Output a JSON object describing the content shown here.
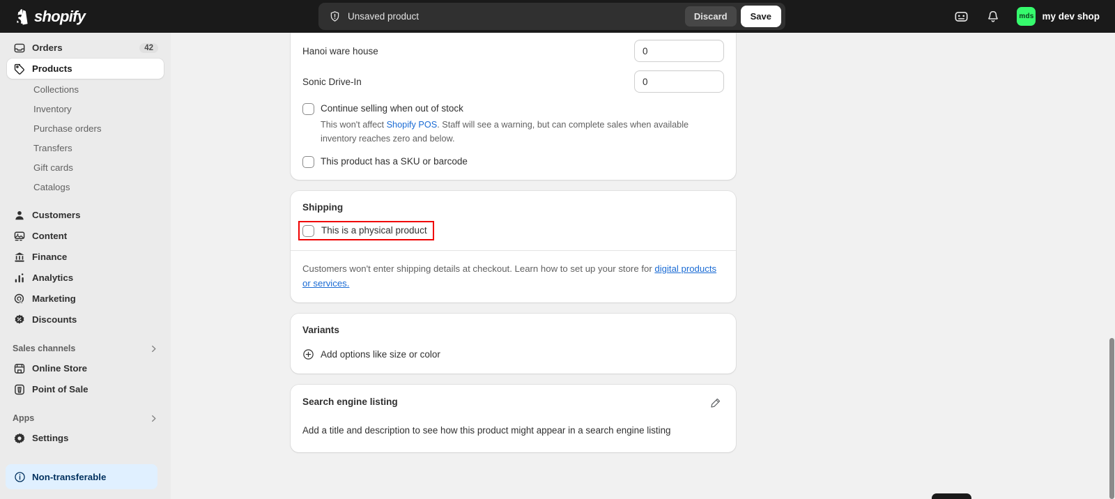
{
  "topbar": {
    "logo_name": "shopify-logo",
    "brand_word": "shopify",
    "savebar": {
      "status_text": "Unsaved product",
      "discard_label": "Discard",
      "save_label": "Save"
    },
    "store_icon": "store-icon",
    "notifications_icon": "bell-icon",
    "avatar_initials": "mds",
    "shop_name": "my dev shop"
  },
  "sidebar": {
    "items": [
      {
        "label": "Orders",
        "icon": "orders-inbox-icon",
        "badge": "42",
        "active": false
      },
      {
        "label": "Products",
        "icon": "products-tag-icon",
        "badge": "",
        "active": true
      }
    ],
    "product_subitems": [
      {
        "label": "Collections"
      },
      {
        "label": "Inventory"
      },
      {
        "label": "Purchase orders"
      },
      {
        "label": "Transfers"
      },
      {
        "label": "Gift cards"
      },
      {
        "label": "Catalogs"
      }
    ],
    "items2": [
      {
        "label": "Customers",
        "icon": "person-icon"
      },
      {
        "label": "Content",
        "icon": "image-content-icon"
      },
      {
        "label": "Finance",
        "icon": "bank-icon"
      },
      {
        "label": "Analytics",
        "icon": "bar-chart-icon"
      },
      {
        "label": "Marketing",
        "icon": "target-icon"
      },
      {
        "label": "Discounts",
        "icon": "discount-badge-icon"
      }
    ],
    "sales_channels": {
      "title": "Sales channels",
      "chevron": "chevron-right-icon",
      "items": [
        {
          "label": "Online Store",
          "icon": "storefront-icon"
        },
        {
          "label": "Point of Sale",
          "icon": "pos-icon"
        }
      ]
    },
    "apps": {
      "title": "Apps",
      "chevron": "chevron-right-icon"
    },
    "settings": {
      "label": "Settings",
      "icon": "gear-icon"
    },
    "banner": {
      "icon": "info-circle-icon",
      "text": "Non-transferable"
    }
  },
  "main": {
    "inventory_card": {
      "locations": [
        {
          "name": "Hanoi ware house",
          "qty": "0"
        },
        {
          "name": "Sonic Drive-In",
          "qty": "0"
        }
      ],
      "continue_selling": {
        "label": "Continue selling when out of stock",
        "checked": false,
        "help_before": "This won't affect ",
        "help_link": "Shopify POS",
        "help_after": ". Staff will see a warning, but can complete sales when available inventory reaches zero and below."
      },
      "sku_barcode": {
        "label": "This product has a SKU or barcode",
        "checked": false
      }
    },
    "shipping_card": {
      "title": "Shipping",
      "physical_product": {
        "label": "This is a physical product",
        "checked": false,
        "highlighted": true
      },
      "note_before": "Customers won't enter shipping details at checkout. Learn how to set up your store for ",
      "note_link": "digital products or services.",
      "note_after": ""
    },
    "variants_card": {
      "title": "Variants",
      "add_icon": "circle-plus-icon",
      "add_label": "Add options like size or color"
    },
    "seo_card": {
      "title": "Search engine listing",
      "edit_icon": "pencil-edit-icon",
      "body": "Add a title and description to see how this product might appear in a search engine listing"
    }
  },
  "colors": {
    "accent_link": "#1a6bd4",
    "highlight_box": "#f00000",
    "avatar_green": "#36fa6d",
    "topbar_bg": "#1a1a1a",
    "sidebar_bg": "#ebebeb",
    "page_bg": "#f1f1f1"
  }
}
